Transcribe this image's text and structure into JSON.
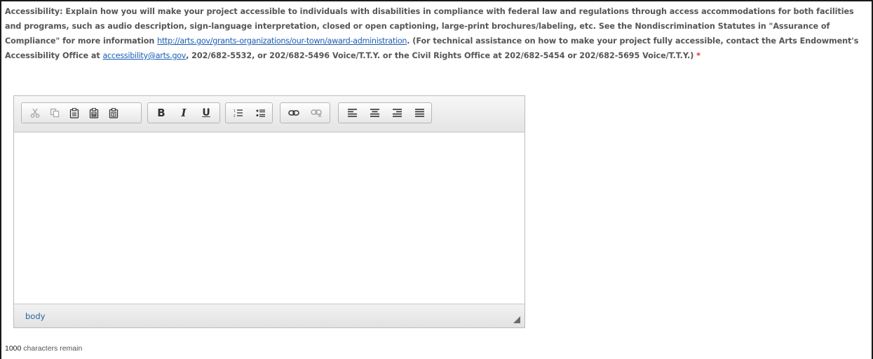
{
  "question": {
    "text_before_link": "Accessibility: Explain how you will make your project accessible to individuals with disabilities in compliance with federal law and regulations through access accommodations for both facilities and programs, such as audio description, sign-language interpretation, closed or open captioning, large-print brochures/labeling, etc. See the Nondiscrimination Statutes in \"Assurance of Compliance\" for more information ",
    "link1": "http://arts.gov/grants-organizations/our-town/award-administration",
    "text_mid": ". (For technical assistance on how to make your project fully accessible, contact the Arts Endowment's Accessibility Office at ",
    "link2": "accessibility@arts.gov",
    "text_after": ", 202/682-5532, or 202/682-5496 Voice/T.T.Y. or the Civil Rights Office at 202/682-5454 or 202/682-5695 Voice/T.T.Y.) ",
    "required_marker": "*"
  },
  "toolbar": {
    "bold_label": "B",
    "italic_label": "I",
    "underline_label": "U",
    "icons": [
      "cut-icon",
      "copy-icon",
      "paste-icon",
      "paste-from-word-icon",
      "paste-as-text-icon",
      "bold-icon",
      "italic-icon",
      "underline-icon",
      "numbered-list-icon",
      "bulleted-list-icon",
      "link-icon",
      "unlink-icon",
      "align-left-icon",
      "align-center-icon",
      "align-right-icon",
      "justify-icon"
    ]
  },
  "editor": {
    "content": "",
    "element_path": "body"
  },
  "counter": {
    "count": "1000",
    "suffix": " characters remain"
  },
  "colors": {
    "link": "#1a5fb4",
    "required": "#e03030",
    "path": "#2a63a8"
  }
}
